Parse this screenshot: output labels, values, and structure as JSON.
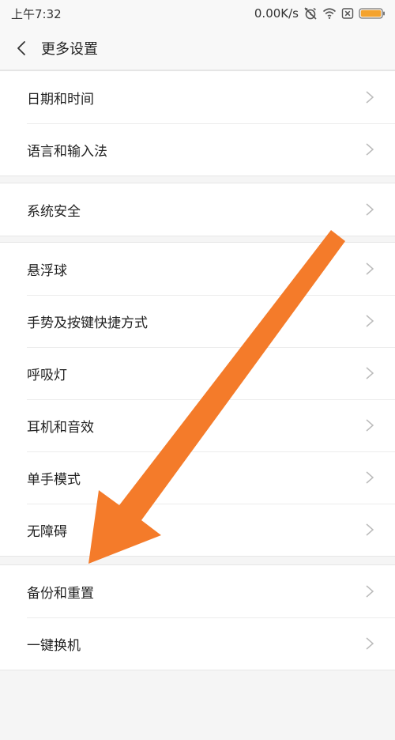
{
  "status_bar": {
    "time": "上午7:32",
    "net_speed": "0.00K/s",
    "icons": [
      "alarm-off-icon",
      "wifi-icon",
      "sim-off-icon",
      "battery-icon"
    ],
    "battery_color": "#f4a32e"
  },
  "header": {
    "title": "更多设置",
    "back_icon": "chevron-left-icon"
  },
  "groups": [
    {
      "items": [
        "日期和时间",
        "语言和输入法"
      ]
    },
    {
      "items": [
        "系统安全"
      ]
    },
    {
      "items": [
        "悬浮球",
        "手势及按键快捷方式",
        "呼吸灯",
        "耳机和音效",
        "单手模式",
        "无障碍"
      ]
    },
    {
      "items": [
        "备份和重置",
        "一键换机"
      ]
    }
  ],
  "annotation": {
    "type": "arrow-icon",
    "color": "#f47b2a"
  }
}
